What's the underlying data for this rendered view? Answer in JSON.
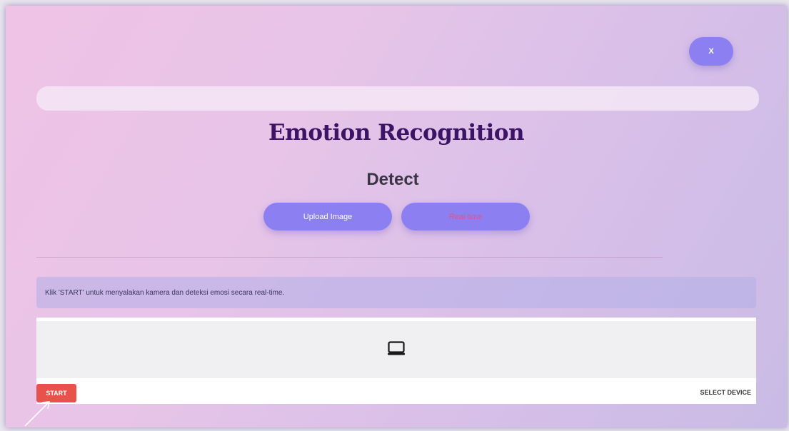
{
  "header": {
    "close_label": "X"
  },
  "search": {
    "placeholder": ""
  },
  "main": {
    "title": "Emotion Recognition",
    "section_title": "Detect",
    "tabs": [
      {
        "label": "Upload Image"
      },
      {
        "label": "Real time"
      }
    ],
    "info_text": "Klik 'START' untuk menyalakan kamera dan deteksi emosi secara real-time."
  },
  "webcam": {
    "start_label": "START",
    "select_device_label": "SELECT DEVICE",
    "placeholder_icon": "laptop-icon"
  },
  "colors": {
    "accent": "#8b7ff2",
    "title": "#3d1366",
    "start_button": "#e8524a",
    "active_tab_text": "#e8547a"
  }
}
